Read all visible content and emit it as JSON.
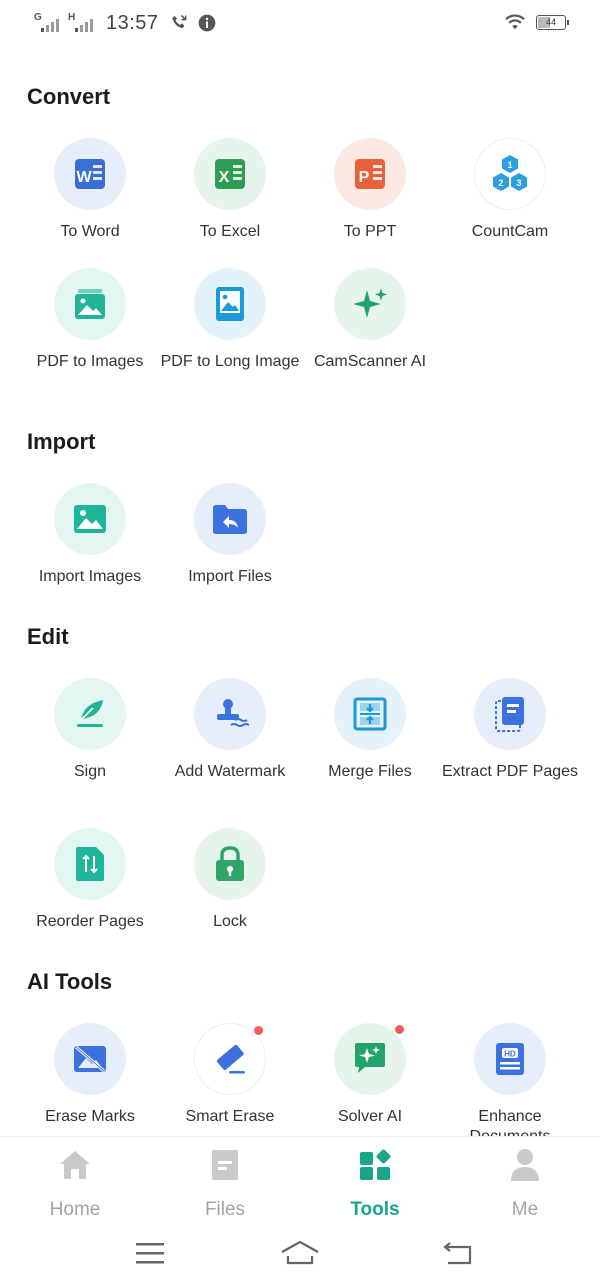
{
  "status_bar": {
    "signal1_label": "G",
    "signal2_label": "H",
    "time": "13:57",
    "battery": "44"
  },
  "sections": {
    "convert": {
      "title": "Convert",
      "items": [
        {
          "label": "To Word",
          "icon": "word-icon"
        },
        {
          "label": "To Excel",
          "icon": "excel-icon"
        },
        {
          "label": "To PPT",
          "icon": "ppt-icon"
        },
        {
          "label": "CountCam",
          "icon": "countcam-icon"
        },
        {
          "label": "PDF to Images",
          "icon": "pdf-to-images-icon"
        },
        {
          "label": "PDF to Long Image",
          "icon": "pdf-to-long-image-icon"
        },
        {
          "label": "CamScanner AI",
          "icon": "sparkle-icon"
        }
      ]
    },
    "import": {
      "title": "Import",
      "items": [
        {
          "label": "Import Images",
          "icon": "image-icon"
        },
        {
          "label": "Import Files",
          "icon": "folder-import-icon"
        }
      ]
    },
    "edit": {
      "title": "Edit",
      "items": [
        {
          "label": "Sign",
          "icon": "signature-icon"
        },
        {
          "label": "Add Watermark",
          "icon": "watermark-icon"
        },
        {
          "label": "Merge Files",
          "icon": "merge-icon"
        },
        {
          "label": "Extract PDF Pages",
          "icon": "extract-pages-icon"
        },
        {
          "label": "Reorder Pages",
          "icon": "reorder-icon"
        },
        {
          "label": "Lock",
          "icon": "lock-icon"
        }
      ]
    },
    "ai_tools": {
      "title": "AI Tools",
      "items": [
        {
          "label": "Erase Marks",
          "icon": "erase-marks-icon"
        },
        {
          "label": "Smart Erase",
          "icon": "eraser-icon"
        },
        {
          "label": "Solver AI",
          "icon": "solver-ai-icon"
        },
        {
          "label": "Enhance Documents",
          "icon": "hd-icon"
        }
      ]
    }
  },
  "bottom_nav": {
    "items": [
      {
        "label": "Home",
        "icon": "home-icon"
      },
      {
        "label": "Files",
        "icon": "files-icon"
      },
      {
        "label": "Tools",
        "icon": "tools-icon",
        "active": true
      },
      {
        "label": "Me",
        "icon": "person-icon"
      }
    ]
  },
  "colors": {
    "accent": "#19a58a",
    "word": "#3a6fd8",
    "excel": "#2e9e57",
    "ppt": "#e8613d",
    "teal": "#1fb59a",
    "blue": "#3c72e0",
    "green": "#2ea66a",
    "badge": "#f25c5c"
  }
}
